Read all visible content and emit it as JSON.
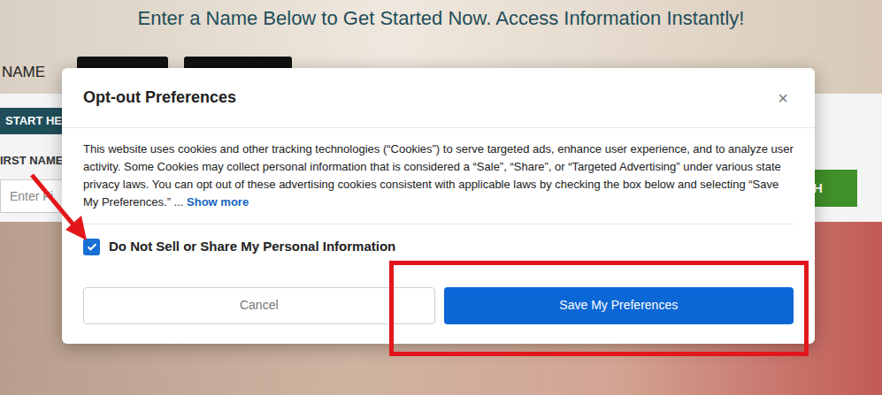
{
  "page": {
    "heading": "Enter a Name Below to Get Started Now. Access Information Instantly!",
    "top_label": "NAME",
    "tab": "START HE",
    "field_label": "IRST NAME",
    "input_placeholder": "Enter Fi",
    "search_button": "H"
  },
  "dialog": {
    "title": "Opt-out Preferences",
    "close": "×",
    "description": "This website uses cookies and other tracking technologies (“Cookies”) to serve targeted ads, enhance user experience, and to analyze user activity. Some Cookies may collect personal information that is considered a “Sale”, “Share”, or “Targeted Advertising” under various state privacy laws. You can opt out of these advertising cookies consistent with applicable laws by checking the box below and selecting “Save My Preferences.” ...",
    "link": "Show more",
    "checkbox": {
      "label": "Do Not Sell or Share My Personal Information",
      "checked": true
    },
    "buttons": [
      {
        "label": "Cancel",
        "kind": "secondary"
      },
      {
        "label": "Save My Preferences",
        "kind": "primary"
      }
    ]
  },
  "annotations": [
    {
      "kind": "arrow"
    },
    {
      "kind": "highlight-box"
    }
  ]
}
